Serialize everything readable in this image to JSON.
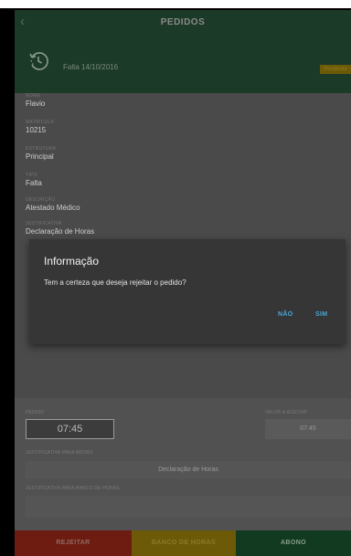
{
  "header": {
    "back_icon": "chevron-left-icon",
    "title": "PEDIDOS"
  },
  "summary": {
    "icon": "clock-history-icon",
    "text": "Falta 14/10/2016",
    "status": "Pendente"
  },
  "details": [
    {
      "label": "NOME",
      "value": "Flavio"
    },
    {
      "label": "MATRÍCULA",
      "value": "10215"
    },
    {
      "label": "ESTRUTURA",
      "value": "Principal"
    },
    {
      "label": "TIPO",
      "value": "Falta"
    },
    {
      "label": "DESCRIÇÃO",
      "value": "Atestado Médico"
    },
    {
      "label": "JUSTIFICATIVA",
      "value": "Declaração de Horas"
    }
  ],
  "form": {
    "pedido_label": "PEDIDO",
    "pedido_value": "07:45",
    "valor_label": "VALOR A ACEITAR",
    "valor_value": "07:45",
    "abono_label": "JUSTIFICATIVA PARA ABONO",
    "abono_value": "Declaração de Horas",
    "banco_label": "JUSTIFICATIVA PARA BANCO DE HORAS",
    "banco_value": ""
  },
  "actions": {
    "reject": "REJEITAR",
    "bank": "BANCO DE HORAS",
    "credit": "ABONO"
  },
  "dialog": {
    "title": "Informação",
    "message": "Tem a certeza que deseja rejeitar o pedido?",
    "no": "NÃO",
    "yes": "SIM"
  },
  "colors": {
    "header_bg": "#1c3a28",
    "reject": "#6e1c12",
    "bank": "#6c5a08",
    "credit": "#123a20",
    "dialog_accent": "#48a6d6"
  }
}
